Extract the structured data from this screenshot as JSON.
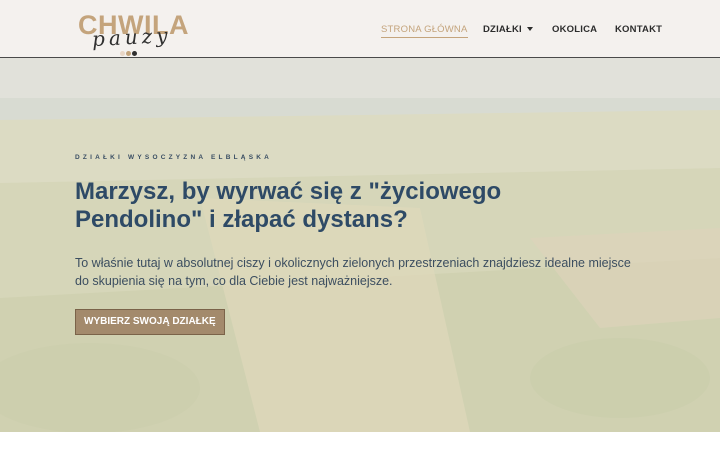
{
  "brand": {
    "logo_main": "CHWILA",
    "logo_script": "pauzy",
    "dot_colors": [
      "#e8d6c6",
      "#c4a47c",
      "#2f2f2f"
    ]
  },
  "nav": {
    "items": [
      {
        "label": "STRONA GŁÓWNA",
        "active": true
      },
      {
        "label": "DZIAŁKI",
        "dropdown": true
      },
      {
        "label": "OKOLICA"
      },
      {
        "label": "KONTAKT"
      }
    ]
  },
  "hero": {
    "eyebrow": "DZIAŁKI WYSOCZYZNA ELBLĄSKA",
    "headline": "Marzysz, by wyrwać się z \"życiowego Pendolino\" i złapać dystans?",
    "subtext": "To właśnie tutaj w absolutnej ciszy i okolicznych zielonych przestrzeniach znajdziesz idealne miejsce do skupienia się na tym, co dla Ciebie jest najważniejsze.",
    "cta_label": "WYBIERZ SWOJĄ DZIAŁKĘ"
  },
  "colors": {
    "accent": "#c4a47c",
    "heading": "#2e4a66",
    "button": "#a38a6c"
  }
}
